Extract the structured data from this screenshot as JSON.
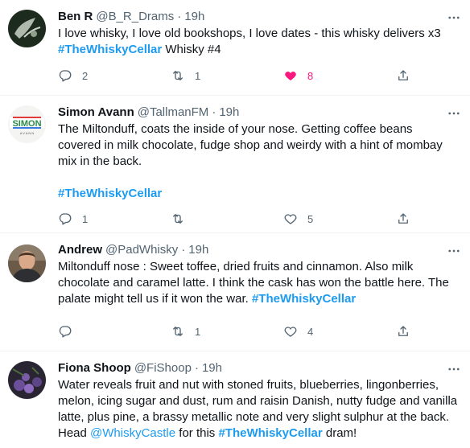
{
  "tweets": [
    {
      "display_name": "Ben R",
      "handle": "@B_R_Drams",
      "separator": "·",
      "time": "19h",
      "text_lines": [
        "I love whisky, I love old bookshops, I love dates - this whisky delivers x3"
      ],
      "hashtag": "#TheWhiskyCellar",
      "after_hashtag": " Whisky #4",
      "replies": "2",
      "retweets": "1",
      "likes": "8",
      "liked": true,
      "avatar_colors": {
        "bg": "#1d2a1e",
        "accent": "#c9d4c6"
      }
    },
    {
      "display_name": "Simon Avann",
      "handle": "@TallmanFM",
      "separator": "·",
      "time": "19h",
      "text": "The Miltonduff, coats the inside of your nose.  Getting coffee beans covered in milk chocolate, fudge shop and weirdy with a hint of mombay mix in the back.",
      "hashtag": "#TheWhiskyCellar",
      "replies": "1",
      "retweets": "",
      "likes": "5",
      "avatar_label": "SIMON",
      "avatar_sub": "A V A N N"
    },
    {
      "display_name": "Andrew",
      "handle": "@PadWhisky",
      "separator": "·",
      "time": "19h",
      "text": "Miltonduff nose : Sweet toffee, dried fruits and cinnamon. Also milk chocolate and caramel latte. I think the cask has won the battle here. The palate might tell us if it won the war.",
      "hashtag": "#TheWhiskyCellar",
      "replies": "",
      "retweets": "1",
      "likes": "4"
    },
    {
      "display_name": "Fiona Shoop",
      "handle": "@FiShoop",
      "separator": "·",
      "time": "19h",
      "text": "Water reveals fruit and nut with stoned fruits, blueberries, lingonberries, melon, icing sugar and dust, rum and raisin Danish, nutty fudge and vanilla latte, plus pine, a brassy metallic note and very slight sulphur at the back. Head",
      "mention": "@WhiskyCastle",
      "mid_text": " for this ",
      "hashtag": "#TheWhiskyCellar",
      "after_hashtag": " dram!"
    }
  ],
  "colors": {
    "accent": "#1d9bf0",
    "secondary_text": "#536471",
    "like_pink": "#f91880",
    "divider": "#eff3f4"
  },
  "icons": {
    "more": "more-icon",
    "reply": "reply-icon",
    "retweet": "retweet-icon",
    "like": "heart-icon",
    "share": "share-icon"
  }
}
